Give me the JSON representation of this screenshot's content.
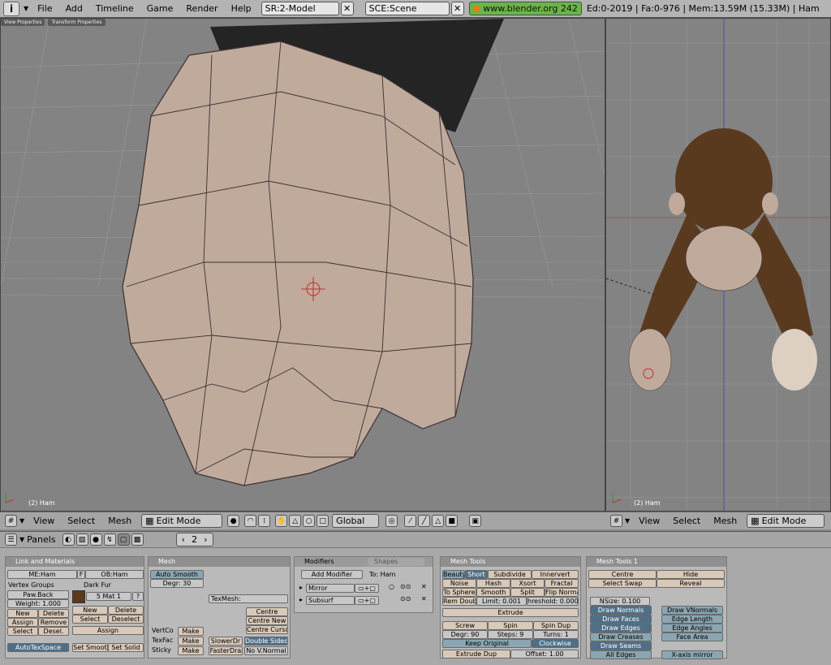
{
  "topbar": {
    "info_icon": "i",
    "menus": [
      "File",
      "Add",
      "Timeline",
      "Game",
      "Render",
      "Help"
    ],
    "screen": "SR:2-Model",
    "scene": "SCE:Scene",
    "url": "www.blender.org 242",
    "stats": "Ed:0-2019 | Fa:0-976 | Mem:13.59M (15.33M) | Ham"
  },
  "viewport_left": {
    "tabs": [
      "View Properties",
      "Transform Properties"
    ],
    "label": "(2) Ham"
  },
  "viewport_right": {
    "label": "(2) Ham"
  },
  "header3d": {
    "view": "View",
    "select": "Select",
    "mesh": "Mesh",
    "mode": "Edit Mode",
    "orientation": "Global"
  },
  "buttons_header": {
    "panels": "Panels",
    "frame": "2"
  },
  "link_materials": {
    "title": "Link and Materials",
    "me": "ME:Ham",
    "f": "F",
    "ob": "OB:Ham",
    "vgroups": "Vertex Groups",
    "vgroup": "Paw.Back",
    "weight": "Weight: 1.000",
    "new": "New",
    "delete": "Delete",
    "assign": "Assign",
    "remove": "Remove",
    "select": "Select",
    "desel": "Desel.",
    "mat_name": "Dark Fur",
    "mat_idx": "5 Mat 1",
    "q": "?",
    "mnew": "New",
    "mdelete": "Delete",
    "mselect": "Select",
    "mdeselect": "Deselect",
    "massign": "Assign",
    "autotex": "AutoTexSpace",
    "smooth": "Set Smoot",
    "solid": "Set Solid"
  },
  "mesh": {
    "title": "Mesh",
    "autosmooth": "Auto Smooth",
    "degr": "Degr: 30",
    "texmesh": "TexMesh:",
    "centre": "Centre",
    "centrenew": "Centre New",
    "centrecursor": "Centre Curso",
    "vertco": "VertCo",
    "texfac": "TexFac",
    "sticky": "Sticky",
    "make": "Make",
    "slower": "SlowerDr",
    "faster": "FasterDra",
    "double": "Double Sided",
    "nonormal": "No V.Normal"
  },
  "modifiers": {
    "title": "Modifiers",
    "shapes": "Shapes",
    "add": "Add Modifier",
    "to": "To: Ham",
    "mirror": "Mirror",
    "subsurf": "Subsurf"
  },
  "meshtools": {
    "title": "Mesh Tools",
    "beauty": "Beauty",
    "short": "Short",
    "subdivide": "Subdivide",
    "innervert": "Innervert",
    "noise": "Noise",
    "hash": "Hash",
    "xsort": "Xsort",
    "fractal": "Fractal",
    "tosphere": "To Sphere",
    "smooth": "Smooth",
    "split": "Split",
    "flip": "Flip Norma",
    "remdoub": "Rem Doub",
    "limit": "Limit: 0.001",
    "threshold": "hreshold: 0.000",
    "extrude": "Extrude",
    "screw": "Screw",
    "spin": "Spin",
    "spindup": "Spin Dup",
    "degr": "Degr: 90",
    "steps": "Steps: 9",
    "turns": "Turns: 1",
    "keep": "Keep Original",
    "clockwise": "Clockwise",
    "extrudedup": "Extrude Dup",
    "offset": "Offset: 1.00"
  },
  "meshtools1": {
    "title": "Mesh Tools 1",
    "centre": "Centre",
    "hide": "Hide",
    "selswap": "Select Swap",
    "reveal": "Reveal",
    "nsize": "NSize: 0.100",
    "normals": "Draw Normals",
    "faces": "Draw Faces",
    "edges": "Draw Edges",
    "creases": "Draw Creases",
    "seams": "Draw Seams",
    "alledges": "All Edges",
    "vnormals": "Draw VNormals",
    "edgelen": "Edge Length",
    "edgeang": "Edge Angles",
    "facearea": "Face Area",
    "xmirror": "X-axis mirror"
  },
  "colors": {
    "viewport_bg": "#838383",
    "mesh_skin": "#c0aa9c",
    "fur": "#5a3a1f",
    "url_green": "#6cb449",
    "button_blue": "#4e6f87"
  }
}
